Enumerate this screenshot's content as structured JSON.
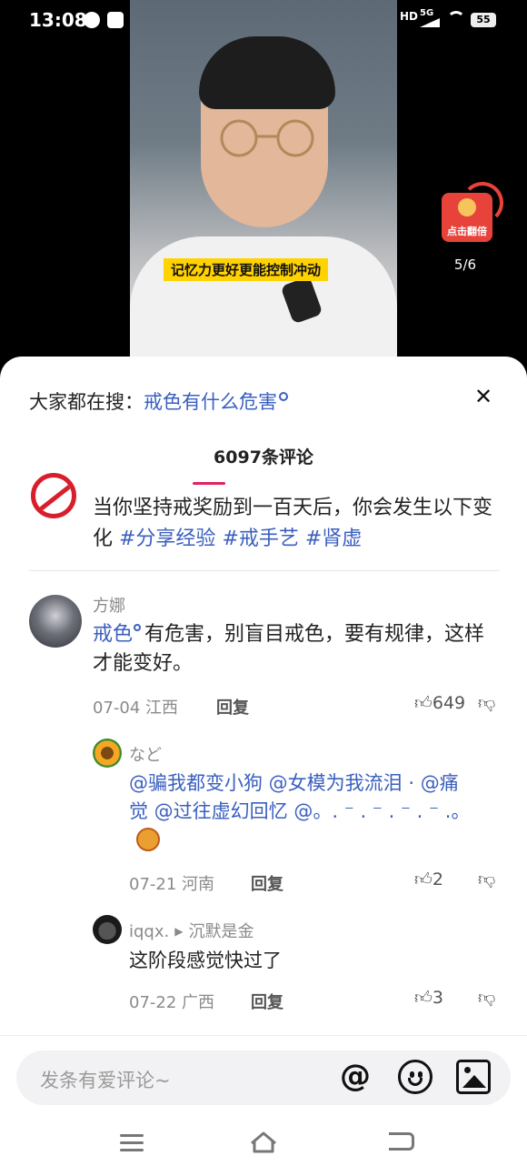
{
  "status_bar": {
    "time": "13:08",
    "signal_labels": [
      "HD",
      "5G"
    ],
    "battery": "55"
  },
  "video": {
    "subtitle": "记忆力更好更能控制冲动",
    "red_packet_label": "点击翻倍",
    "page_counter": "5/6"
  },
  "comment_sheet": {
    "search_prefix": "大家都在搜：",
    "search_term": "戒色有什么危害",
    "close_symbol": "✕",
    "comment_count": "6097条评论",
    "intro": {
      "text": "当你坚持戒奖励到一百天后，你会发生以下变化 ",
      "tags": [
        "#分享经验",
        "#戒手艺",
        "#肾虚"
      ]
    },
    "comments": [
      {
        "author": "方娜",
        "link": "戒色",
        "text": "有危害，别盲目戒色，要有规律，这样才能变好。",
        "date_location": "07-04 江西",
        "reply_label": "回复",
        "likes": "649"
      },
      {
        "author": "など",
        "text": "@骗我都变小狗 @女模为我流泪 · @痛觉 @过往虚幻回忆 @。. ⁻ . ⁻ . ⁻ . ⁻ .。",
        "date_location": "07-21 河南",
        "reply_label": "回复",
        "likes": "2"
      },
      {
        "author": "iqqx.",
        "reply_to": "沉默是金",
        "text": "这阶段感觉快过了",
        "date_location": "07-22 广西",
        "reply_label": "回复",
        "likes": "3"
      }
    ]
  },
  "composer": {
    "placeholder": "发条有爱评论~",
    "at_symbol": "@",
    "icons": [
      "at-icon",
      "emoji-icon",
      "image-icon"
    ]
  },
  "colors": {
    "link": "#3a5fbf",
    "accent": "#e0245e",
    "subtitle_bg": "#ffd200",
    "red_packet": "#e8433a"
  }
}
